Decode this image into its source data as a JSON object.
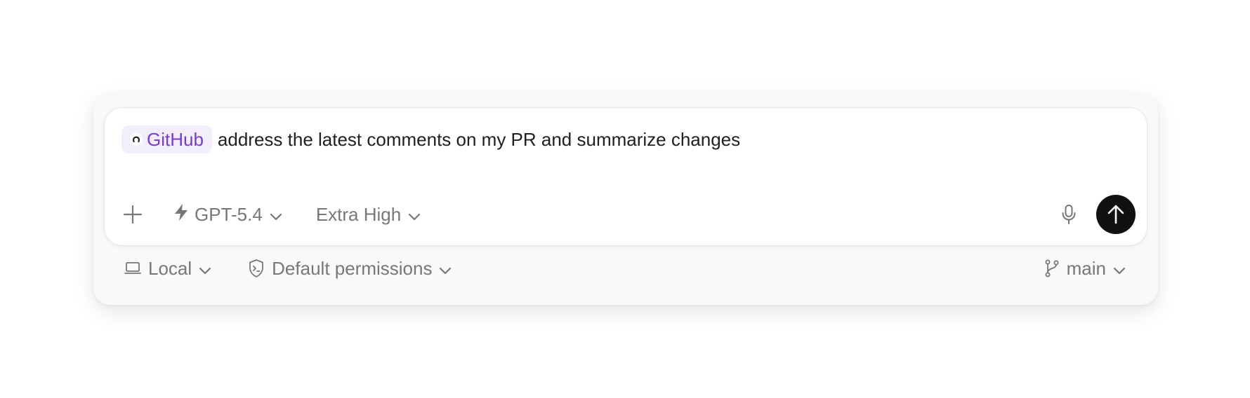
{
  "composer": {
    "mention": {
      "label": "GitHub",
      "icon": "github-icon"
    },
    "prompt_text": "address the latest comments on my PR and summarize changes"
  },
  "toolbar": {
    "add_icon": "plus-icon",
    "model": {
      "label": "GPT-5.4",
      "icon": "bolt-icon"
    },
    "effort": {
      "label": "Extra High"
    },
    "mic_icon": "microphone-icon",
    "send_icon": "arrow-up-icon"
  },
  "footer": {
    "environment": {
      "label": "Local",
      "icon": "laptop-icon"
    },
    "permissions": {
      "label": "Default permissions",
      "icon": "shield-terminal-icon"
    },
    "branch": {
      "label": "main",
      "icon": "git-branch-icon"
    }
  },
  "colors": {
    "mention_text": "#7a3ad6",
    "mention_bg": "#f3eefc",
    "send_button": "#111111",
    "muted_text": "#777777"
  }
}
